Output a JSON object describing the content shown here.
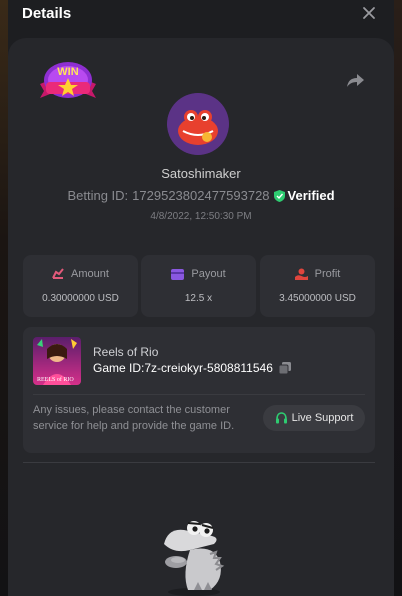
{
  "header": {
    "title": "Details"
  },
  "player": {
    "username": "Satoshimaker",
    "betting_id_label": "Betting ID:",
    "betting_id": "1729523802477593728",
    "verified_label": "Verified",
    "date": "4/8/2022, 12:50:30 PM"
  },
  "badge": {
    "text": "WIN"
  },
  "stats": [
    {
      "label": "Amount",
      "value": "0.30000000 USD",
      "icon": "amount-icon",
      "color": "#e25a7a"
    },
    {
      "label": "Payout",
      "value": "12.5 x",
      "icon": "payout-card-icon",
      "color": "#8a58e0"
    },
    {
      "label": "Profit",
      "value": "3.45000000 USD",
      "icon": "profit-icon",
      "color": "#e0453d"
    }
  ],
  "game": {
    "name": "Reels of Rio",
    "id_label": "Game ID:",
    "id": "7z-creiokyr-5808811546",
    "thumb_text": "REELS of RIO"
  },
  "help": {
    "text": "Any issues, please contact the customer service for help and provide the game ID.",
    "support_label": "Live Support"
  },
  "colors": {
    "accent_green": "#2ecc71",
    "background": "#26272b"
  }
}
